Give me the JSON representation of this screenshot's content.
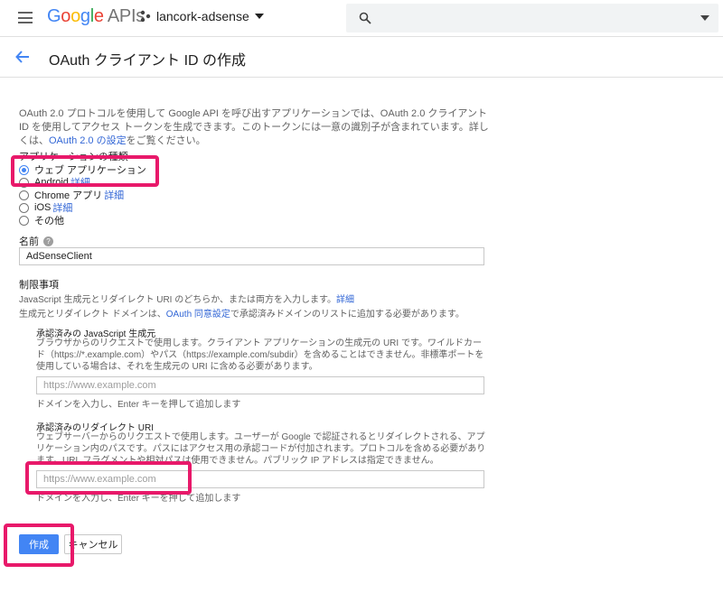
{
  "topbar": {
    "logo_google": "Google",
    "logo_apis": "APIs",
    "project_name": "lancork-adsense",
    "search_placeholder": ""
  },
  "header": {
    "title": "OAuth クライアント ID の作成"
  },
  "intro": {
    "text": "OAuth 2.0 プロトコルを使用して Google API を呼び出すアプリケーションでは、OAuth 2.0 クライアント ID を使用してアクセス トークンを生成できます。このトークンには一意の識別子が含まれています。詳しくは、",
    "link": "OAuth 2.0 の設定",
    "suffix": "をご覧ください。"
  },
  "app_type": {
    "label": "アプリケーションの種類",
    "options": [
      {
        "label": "ウェブ アプリケーション",
        "detail": "",
        "selected": true
      },
      {
        "label": "Android",
        "detail": "詳細",
        "selected": false
      },
      {
        "label": "Chrome アプリ",
        "detail": "詳細",
        "selected": false
      },
      {
        "label": "iOS",
        "detail": "詳細",
        "selected": false
      },
      {
        "label": "その他",
        "detail": "",
        "selected": false
      }
    ]
  },
  "name": {
    "label": "名前",
    "value": "AdSenseClient"
  },
  "restrictions": {
    "title": "制限事項",
    "desc1": "JavaScript 生成元とリダイレクト URI のどちらか、または両方を入力します。",
    "desc1_link": "詳細",
    "desc2_pre": "生成元とリダイレクト ドメインは、",
    "desc2_link": "OAuth 同意設定",
    "desc2_post": "で承認済みドメインのリストに追加する必要があります。",
    "js_origins": {
      "title": "承認済みの JavaScript 生成元",
      "desc": "ブラウザからのリクエストで使用します。クライアント アプリケーションの生成元の URI です。ワイルドカード（https://*.example.com）やパス（https://example.com/subdir）を含めることはできません。非標準ポートを使用している場合は、それを生成元の URI に含める必要があります。",
      "placeholder": "https://www.example.com",
      "hint": "ドメインを入力し、Enter キーを押して追加します"
    },
    "redirect_uris": {
      "title": "承認済みのリダイレクト URI",
      "desc": "ウェブサーバーからのリクエストで使用します。ユーザーが Google で認証されるとリダイレクトされる、アプリケーション内のパスです。パスにはアクセス用の承認コードが付加されます。プロトコルを含める必要があります。URL フラグメントや相対パスは使用できません。パブリック IP アドレスは指定できません。",
      "placeholder": "https://www.example.com",
      "hint": "ドメインを入力し、Enter キーを押して追加します"
    }
  },
  "actions": {
    "create": "作成",
    "cancel": "キャンセル"
  },
  "colors": {
    "accent": "#4285f4",
    "link": "#3367d6",
    "highlight": "#e8196a"
  }
}
